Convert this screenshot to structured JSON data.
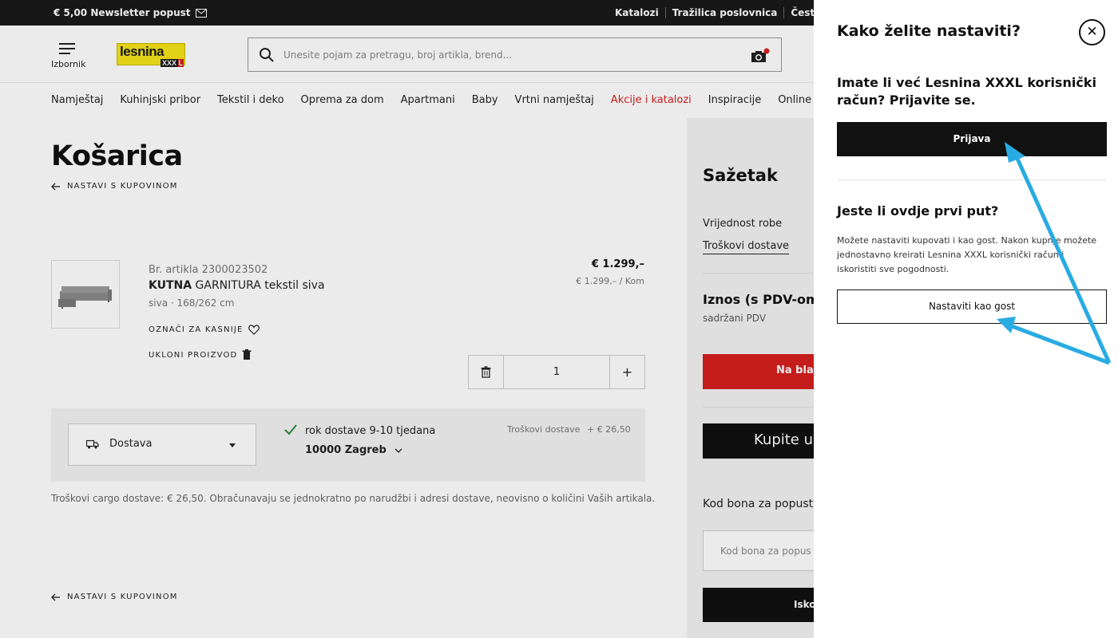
{
  "topbar": {
    "promo_text": "€ 5,00 Newsletter popust",
    "links": [
      "Katalozi",
      "Tražilica poslovnica",
      "Česta pitanja"
    ]
  },
  "header": {
    "menu_label": "Izbornik",
    "logo_text": "lesnina",
    "logo_sub": "XXX",
    "logo_sub2": "L",
    "search_placeholder": "Unesite pojam za pretragu, broj artikla, brend..."
  },
  "nav": [
    "Namještaj",
    "Kuhinjski pribor",
    "Tekstil i deko",
    "Oprema za dom",
    "Apartmani",
    "Baby",
    "Vrtni namještaj",
    "Akcije i katalozi",
    "Inspiracije",
    "Online Only"
  ],
  "cart": {
    "title": "Košarica",
    "continue_link": "NASTAVI S KUPOVINOM",
    "item": {
      "article_no": "Br. artikla 2300023502",
      "name_bold": "KUTNA",
      "name_rest": " GARNITURA tekstil siva",
      "meta": "siva · 168/262 cm",
      "save_later": "OZNAČI ZA KASNIJE",
      "remove": "UKLONI PROIZVOD",
      "price": "€ 1.299,–",
      "price_unit": "€ 1.299,– / Kom",
      "quantity": "1",
      "plus": "+"
    },
    "delivery": {
      "method": "Dostava",
      "time": "rok dostave 9-10 tjedana",
      "city": "10000 Zagreb",
      "cost_label": "Troškovi dostave",
      "cost": "+ € 26,50"
    },
    "cargo_note": "Troškovi cargo dostave: € 26,50. Obračunavaju se jednokratno po narudžbi i adresi dostave, neovisno o količini Vaših artikala."
  },
  "summary": {
    "title": "Sažetak",
    "goods_value": "Vrijednost robe",
    "shipping": "Troškovi dostave",
    "total": "Iznos (s PDV-om)",
    "vat": "sadržani PDV",
    "pay_button": "Na blag",
    "buy_button": "Kupite u",
    "voucher_title": "Kod bona za popust",
    "voucher_placeholder": "Kod bona za popus",
    "apply_button": "Isko"
  },
  "modal": {
    "title": "Kako želite nastaviti?",
    "close": "✕",
    "login_heading": "Imate li već Lesnina XXXL korisnički račun? Prijavite se.",
    "login_button": "Prijava",
    "guest_heading": "Jeste li ovdje prvi put?",
    "guest_text": "Možete nastaviti kupovati i kao gost. Nakon kupnje možete jednostavno kreirati Lesnina XXXL korisnički račun i iskoristiti sve pogodnosti.",
    "guest_button": "Nastaviti kao gost"
  },
  "colors": {
    "accent_red": "#d5201f",
    "logo_yellow": "#f5e31a",
    "annotation_arrow": "#29abe2"
  },
  "icons": [
    "mail-icon",
    "menu-icon",
    "search-icon",
    "camera-icon",
    "arrow-left-icon",
    "heart-icon",
    "trash-icon",
    "truck-icon",
    "check-icon",
    "chevron-down-icon",
    "close-icon"
  ]
}
